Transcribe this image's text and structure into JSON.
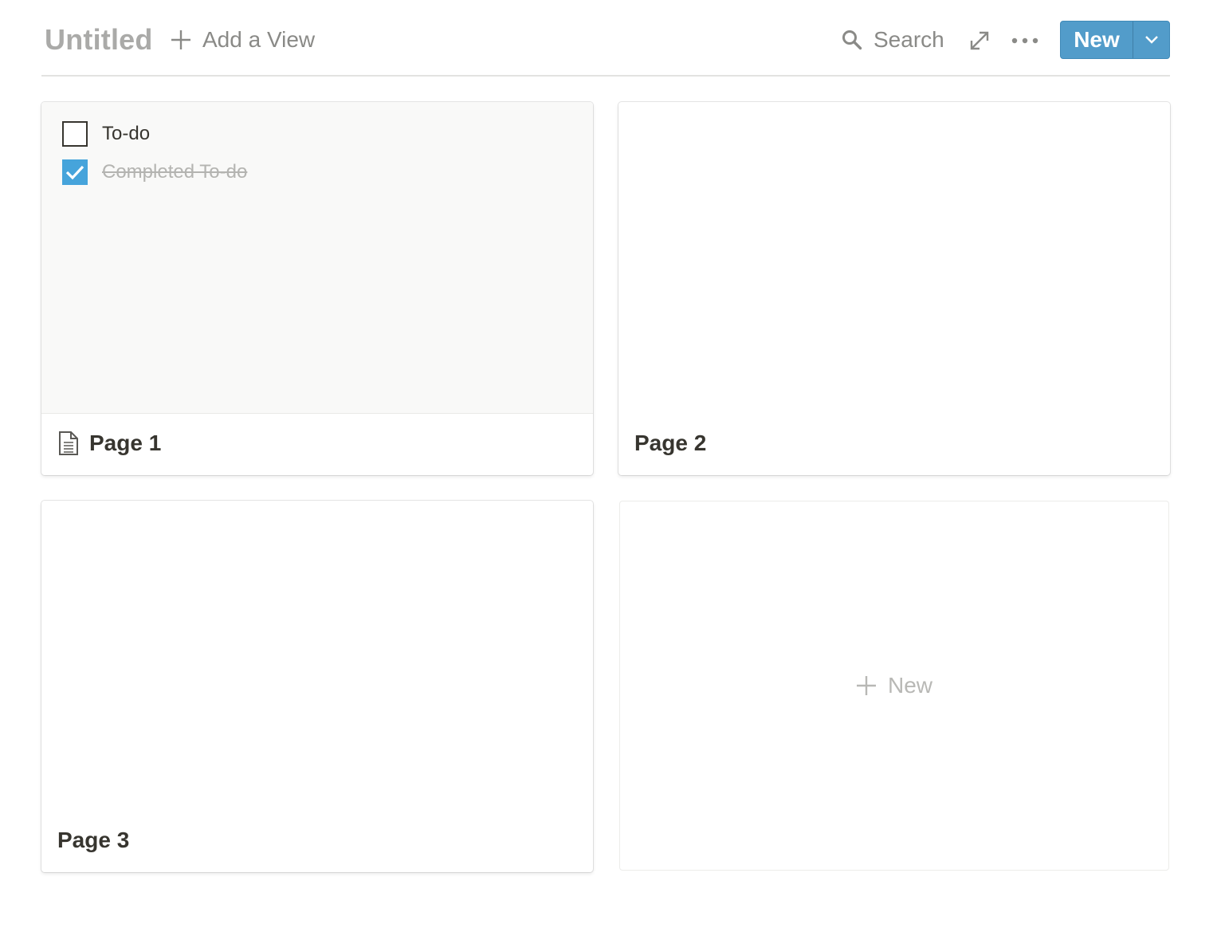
{
  "header": {
    "title": "Untitled",
    "add_view_label": "Add a View",
    "search_label": "Search",
    "new_button_label": "New"
  },
  "cards": [
    {
      "title": "Page 1",
      "has_icon": true,
      "icon": "document-icon",
      "preview": {
        "todos": [
          {
            "text": "To-do",
            "checked": false
          },
          {
            "text": "Completed To-do",
            "checked": true
          }
        ]
      }
    },
    {
      "title": "Page 2"
    },
    {
      "title": "Page 3"
    }
  ],
  "new_card_label": "New",
  "icons": {
    "add_view": "plus-icon",
    "search": "search-icon",
    "expand": "expand-arrows-icon",
    "more": "more-horizontal-icon",
    "new_menu": "chevron-down-icon",
    "new_card": "plus-icon"
  },
  "colors": {
    "accent": "#529cca",
    "checkbox_checked": "#46a4db",
    "title_muted": "#aaaaa8",
    "text": "#37352f"
  }
}
